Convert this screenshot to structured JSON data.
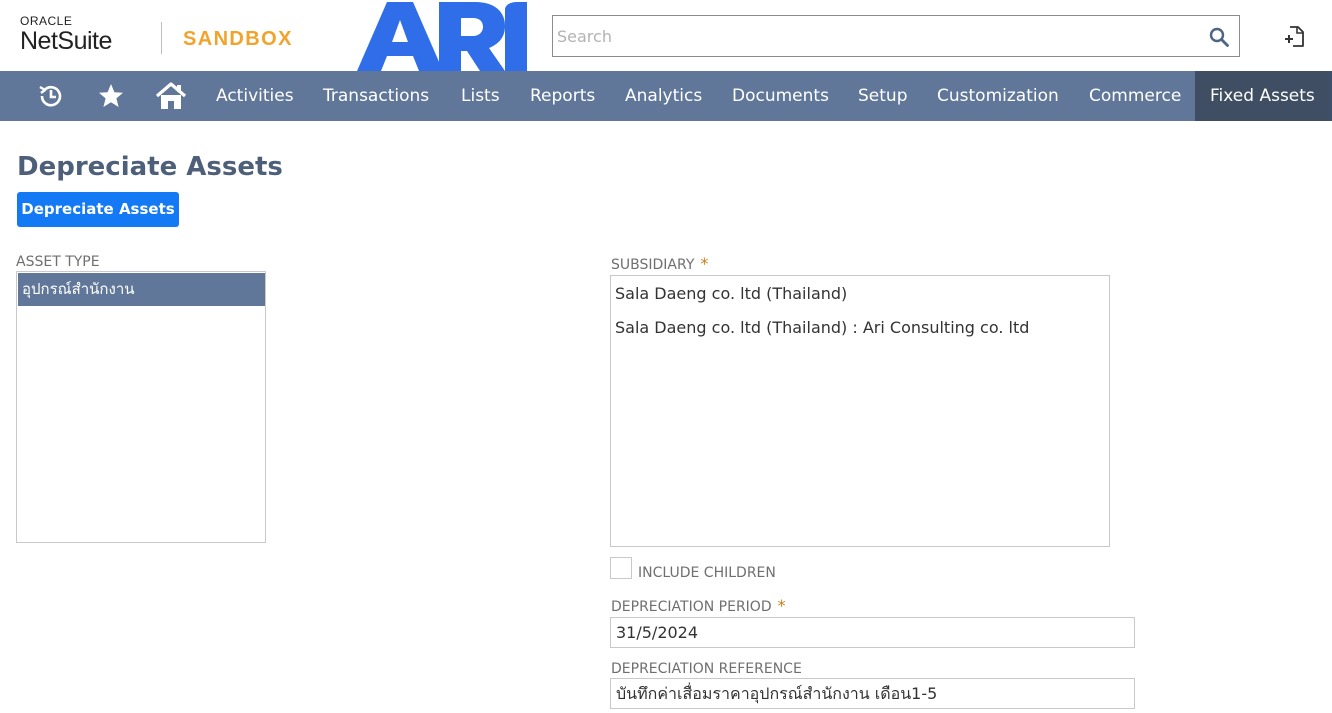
{
  "header": {
    "oracle_text": "ORACLE",
    "netsuite_text": "NetSuite",
    "environment_badge": "SANDBOX",
    "company_logo_text": "ARI",
    "search_placeholder": "Search"
  },
  "nav": {
    "items": [
      {
        "label": "Activities"
      },
      {
        "label": "Transactions"
      },
      {
        "label": "Lists"
      },
      {
        "label": "Reports"
      },
      {
        "label": "Analytics"
      },
      {
        "label": "Documents"
      },
      {
        "label": "Setup"
      },
      {
        "label": "Customization"
      },
      {
        "label": "Commerce"
      },
      {
        "label": "Fixed Assets",
        "active": true
      }
    ],
    "icons": [
      "recent-records-icon",
      "favorites-star-icon",
      "home-icon"
    ]
  },
  "page": {
    "title": "Depreciate Assets",
    "primary_button": "Depreciate Assets"
  },
  "form": {
    "asset_type": {
      "label": "ASSET TYPE",
      "options": [
        "อุปกรณ์สำนักงาน"
      ],
      "selected": "อุปกรณ์สำนักงาน"
    },
    "subsidiary": {
      "label": "SUBSIDIARY",
      "required_marker": "*",
      "options": [
        "Sala Daeng co. ltd (Thailand)",
        "Sala Daeng co. ltd (Thailand) : Ari Consulting co. ltd"
      ]
    },
    "include_children": {
      "label": "INCLUDE CHILDREN",
      "checked": false
    },
    "depreciation_period": {
      "label": "DEPRECIATION PERIOD",
      "required_marker": "*",
      "value": "31/5/2024"
    },
    "depreciation_reference": {
      "label": "DEPRECIATION REFERENCE",
      "value": "บันทึกค่าเสื่อมราคาอุปกรณ์สำนักงาน เดือน1-5"
    }
  },
  "colors": {
    "nav_bg": "#607799",
    "nav_active_bg": "#3f4e63",
    "primary_button": "#1379f5",
    "sandbox_text": "#f2a32c",
    "ari_logo": "#2f6ee8",
    "title_text": "#4d5f79",
    "required_marker": "#c77f14"
  }
}
